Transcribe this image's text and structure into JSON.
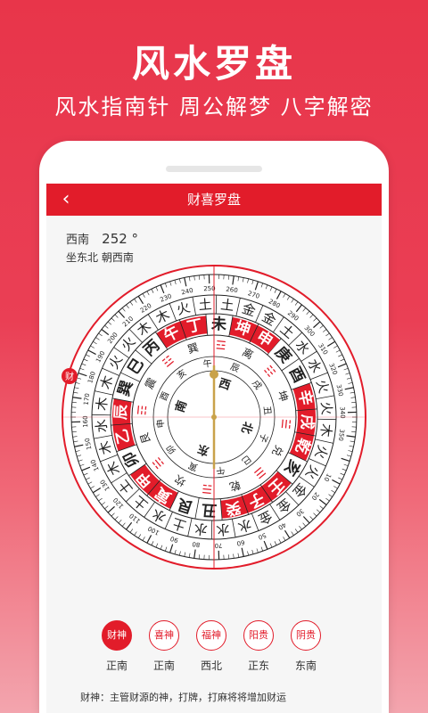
{
  "hero": {
    "title": "风水罗盘",
    "subtitle": "风水指南针 周公解梦 八字解密"
  },
  "nav": {
    "title": "财喜罗盘",
    "back_icon": "chevron-left"
  },
  "reading": {
    "direction": "西南",
    "degree": "252 °",
    "facing": "坐东北 朝西南"
  },
  "compass": {
    "north_marker": "财",
    "bagua": [
      "南",
      "西",
      "北",
      "东"
    ],
    "inner_ring": [
      "兑",
      "☰",
      "乾",
      "☴",
      "坎",
      "☵",
      "艮",
      "☶",
      "震",
      "☳",
      "巽",
      "☲",
      "离",
      "☷",
      "坤",
      "☱"
    ],
    "inner_ring2": [
      "子",
      "巳",
      "午",
      "寅",
      "卯",
      "申",
      "酉",
      "亥",
      "午",
      "辰",
      "戌",
      "丑"
    ],
    "ring_mountains": [
      "庚",
      "酉",
      "辛",
      "戌",
      "乾",
      "亥",
      "壬",
      "子",
      "癸",
      "丑",
      "艮",
      "寅",
      "甲",
      "卯",
      "乙",
      "辰",
      "巽",
      "巳",
      "丙",
      "午",
      "丁",
      "未",
      "坤",
      "申"
    ],
    "highlighted_mountains": [
      "坤",
      "申",
      "辛",
      "戌",
      "乾",
      "壬",
      "子",
      "癸",
      "寅",
      "甲",
      "乙",
      "辰",
      "丁",
      "午"
    ],
    "ring_elements": [
      "火",
      "火",
      "金",
      "金",
      "金",
      "水",
      "水",
      "水",
      "土",
      "水",
      "土",
      "土",
      "木",
      "木",
      "水",
      "木",
      "木",
      "火",
      "火",
      "木",
      "木",
      "火",
      "土",
      "土",
      "金",
      "金",
      "土",
      "水",
      "水",
      "火",
      "火",
      "木"
    ],
    "degree_labels": [
      "10",
      "20",
      "30",
      "40",
      "50",
      "60",
      "70",
      "80",
      "90",
      "100",
      "110",
      "120",
      "130",
      "140",
      "150",
      "160",
      "170",
      "180",
      "190",
      "200",
      "210",
      "220",
      "230",
      "240",
      "250",
      "260",
      "270",
      "280",
      "290",
      "300",
      "310",
      "320",
      "330",
      "340",
      "350"
    ],
    "heading_deg": 252,
    "colors": {
      "red": "#e21c2a",
      "dark": "#222222",
      "needle": "#c9a24a"
    }
  },
  "gods": [
    {
      "label": "财神",
      "direction": "正南",
      "active": true
    },
    {
      "label": "喜神",
      "direction": "正南",
      "active": false
    },
    {
      "label": "福神",
      "direction": "西北",
      "active": false
    },
    {
      "label": "阳贵",
      "direction": "正东",
      "active": false
    },
    {
      "label": "阴贵",
      "direction": "东南",
      "active": false
    }
  ],
  "footnote": "财神：主管财源的神，打牌，打麻将将增加财运"
}
